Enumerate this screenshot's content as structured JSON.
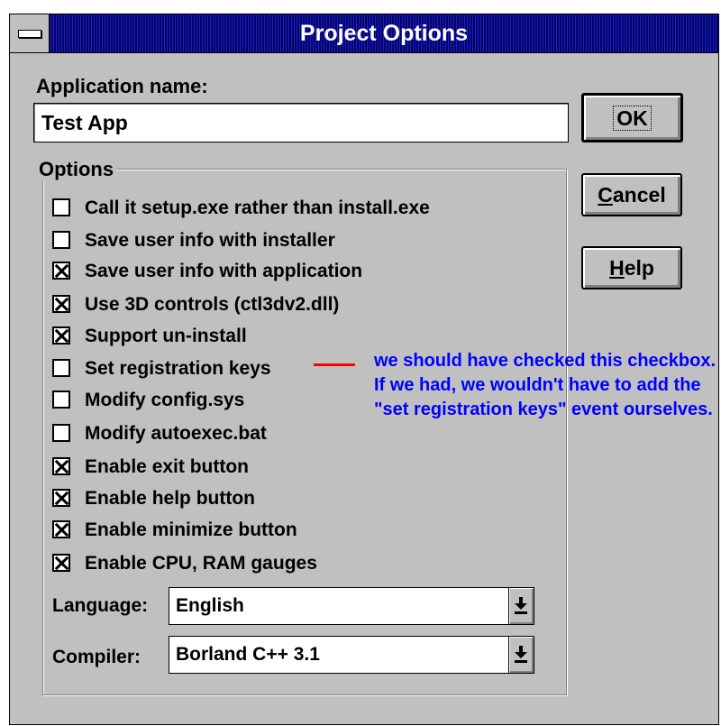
{
  "window": {
    "title": "Project Options"
  },
  "app_name": {
    "label": "Application name:",
    "value": "Test App"
  },
  "buttons": {
    "ok": "OK",
    "cancel": "Cancel",
    "help": "Help"
  },
  "options": {
    "legend": "Options",
    "items": [
      {
        "label": "Call it setup.exe rather than install.exe",
        "checked": false
      },
      {
        "label": "Save user info with installer",
        "checked": false
      },
      {
        "label": "Save user info with application",
        "checked": true
      },
      {
        "label": "Use 3D controls (ctl3dv2.dll)",
        "checked": true
      },
      {
        "label": "Support un-install",
        "checked": true
      },
      {
        "label": "Set registration keys",
        "checked": false
      },
      {
        "label": "Modify config.sys",
        "checked": false
      },
      {
        "label": "Modify autoexec.bat",
        "checked": false
      },
      {
        "label": "Enable exit button",
        "checked": true
      },
      {
        "label": "Enable help button",
        "checked": true
      },
      {
        "label": "Enable minimize button",
        "checked": true
      },
      {
        "label": "Enable CPU, RAM gauges",
        "checked": true
      }
    ]
  },
  "language": {
    "label": "Language:",
    "value": "English"
  },
  "compiler": {
    "label": "Compiler:",
    "value": "Borland C++ 3.1"
  },
  "annotation": {
    "text": "we should have checked this checkbox. If we had, we wouldn't have to add the \"set registration keys\" event ourselves.",
    "text_color": "#0000ff",
    "line_color": "#ff0000"
  },
  "colors": {
    "titlebar": "#000080",
    "face": "#c0c0c0"
  }
}
